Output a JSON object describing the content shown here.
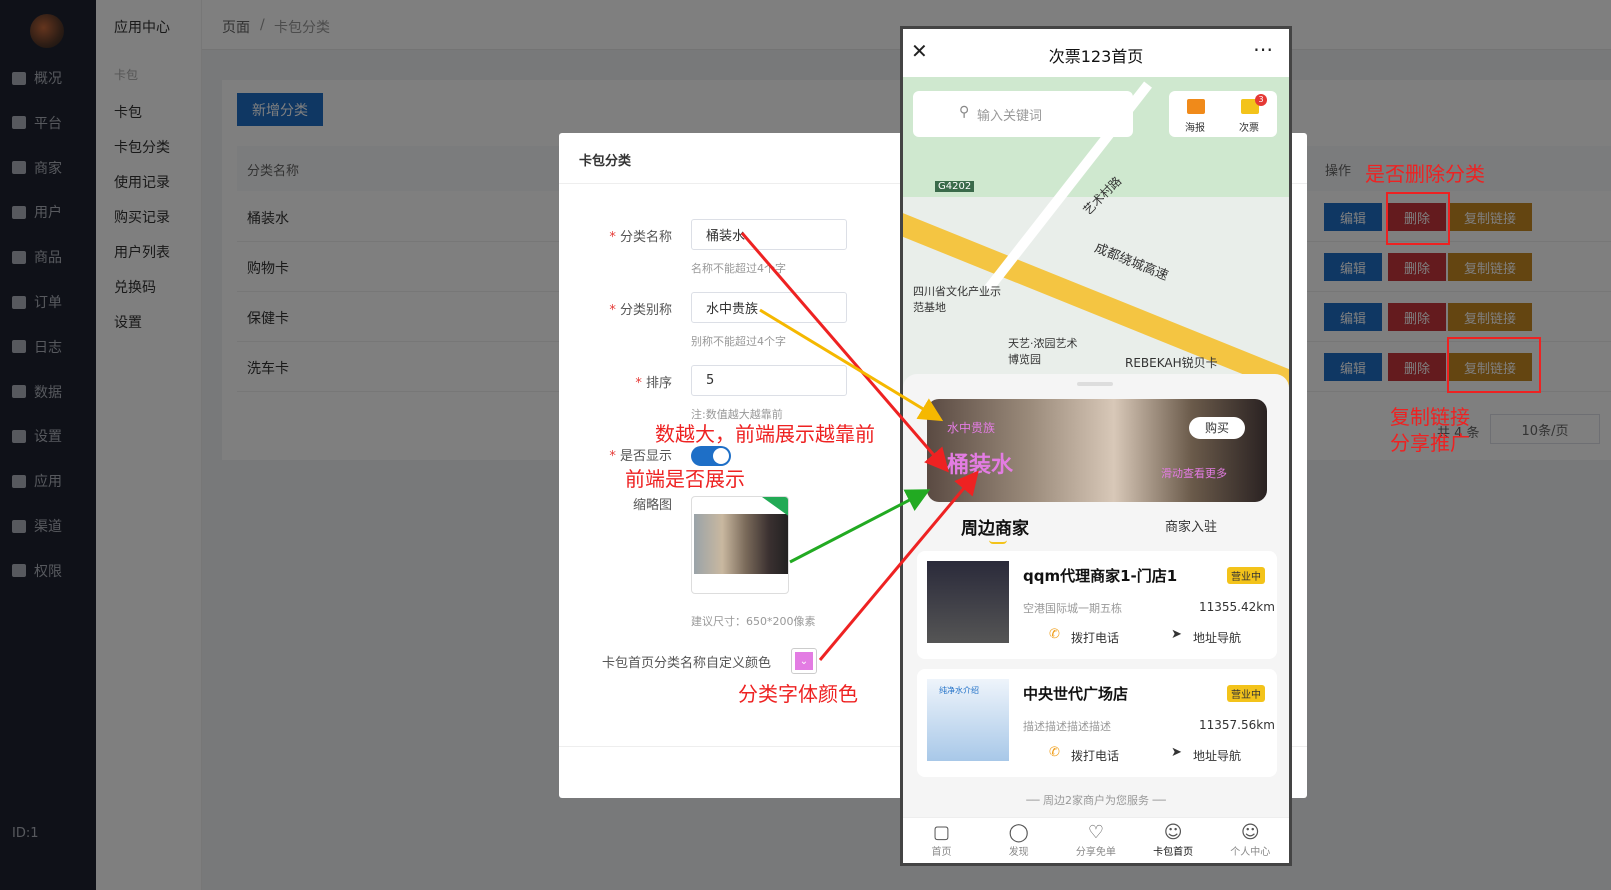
{
  "nav": {
    "items": [
      "概况",
      "平台",
      "商家",
      "用户",
      "商品",
      "订单",
      "日志",
      "数据",
      "设置",
      "应用",
      "渠道",
      "权限"
    ],
    "id_text": "ID:1"
  },
  "menu": {
    "title": "应用中心",
    "group": "卡包",
    "items": [
      "卡包",
      "卡包分类",
      "使用记录",
      "购买记录",
      "用户列表",
      "兑换码",
      "设置"
    ]
  },
  "breadcrumb": {
    "root": "页面",
    "sep": "/",
    "current": "卡包分类"
  },
  "toolbar": {
    "add_label": "新增分类"
  },
  "table": {
    "headers": [
      "分类名称",
      "操作"
    ],
    "rows": [
      "桶装水",
      "购物卡",
      "保健卡",
      "洗车卡"
    ],
    "actions": {
      "edit": "编辑",
      "delete": "删除",
      "copy": "复制链接"
    }
  },
  "pagination": {
    "total": "共 4 条",
    "page_size": "10条/页"
  },
  "modal": {
    "title": "卡包分类",
    "fields": {
      "name": {
        "label": "分类名称",
        "value": "桶装水",
        "hint": "名称不能超过4个字"
      },
      "alias": {
        "label": "分类别称",
        "value": "水中贵族",
        "hint": "别称不能超过4个字"
      },
      "sort": {
        "label": "排序",
        "value": "5",
        "hint": "注:数值越大越靠前"
      },
      "show": {
        "label": "是否显示"
      },
      "thumb": {
        "label": "缩略图",
        "hint": "建议尺寸：650*200像素"
      },
      "color": {
        "label": "卡包首页分类名称自定义颜色"
      }
    }
  },
  "phone": {
    "title": "次票123首页",
    "search_placeholder": "输入关键词",
    "quick": [
      {
        "label": "海报"
      },
      {
        "label": "次票",
        "badge": "3"
      }
    ],
    "map_labels": {
      "road": "成都绕城高速",
      "village": "艺术村路",
      "g": "G4202",
      "park": "四川省文化产业示范基地",
      "museum": "天艺·浓园艺术博览园",
      "mall": "REBEKAH锐贝卡"
    },
    "banner": {
      "alias": "水中贵族",
      "name": "桶装水",
      "buy": "购买",
      "more": "滑动查看更多"
    },
    "tabs": [
      "周边商家",
      "商家入驻"
    ],
    "shops": [
      {
        "name": "qqm代理商家1-门店1",
        "status": "营业中",
        "addr": "空港国际城一期五栋",
        "dist": "11355.42km",
        "call": "拨打电话",
        "nav": "地址导航"
      },
      {
        "name": "中央世代广场店",
        "status": "营业中",
        "addr": "描述描述描述描述",
        "dist": "11357.56km",
        "call": "拨打电话",
        "nav": "地址导航",
        "thumb_text": "纯净水介绍"
      }
    ],
    "footer_text": "周边2家商户为您服务",
    "bottom_nav": [
      "首页",
      "发现",
      "分享免单",
      "卡包首页",
      "个人中心"
    ]
  },
  "annotations": {
    "delete": "是否删除分类",
    "copy_line1": "复制链接",
    "copy_line2": "分享推广",
    "sort": "数越大，前端展示越靠前",
    "show": "前端是否展示",
    "color": "分类字体颜色"
  },
  "colors": {
    "primary": "#1e6fc7",
    "danger": "#c9373d",
    "warning": "#c98a22",
    "note_red": "#ee2222"
  }
}
